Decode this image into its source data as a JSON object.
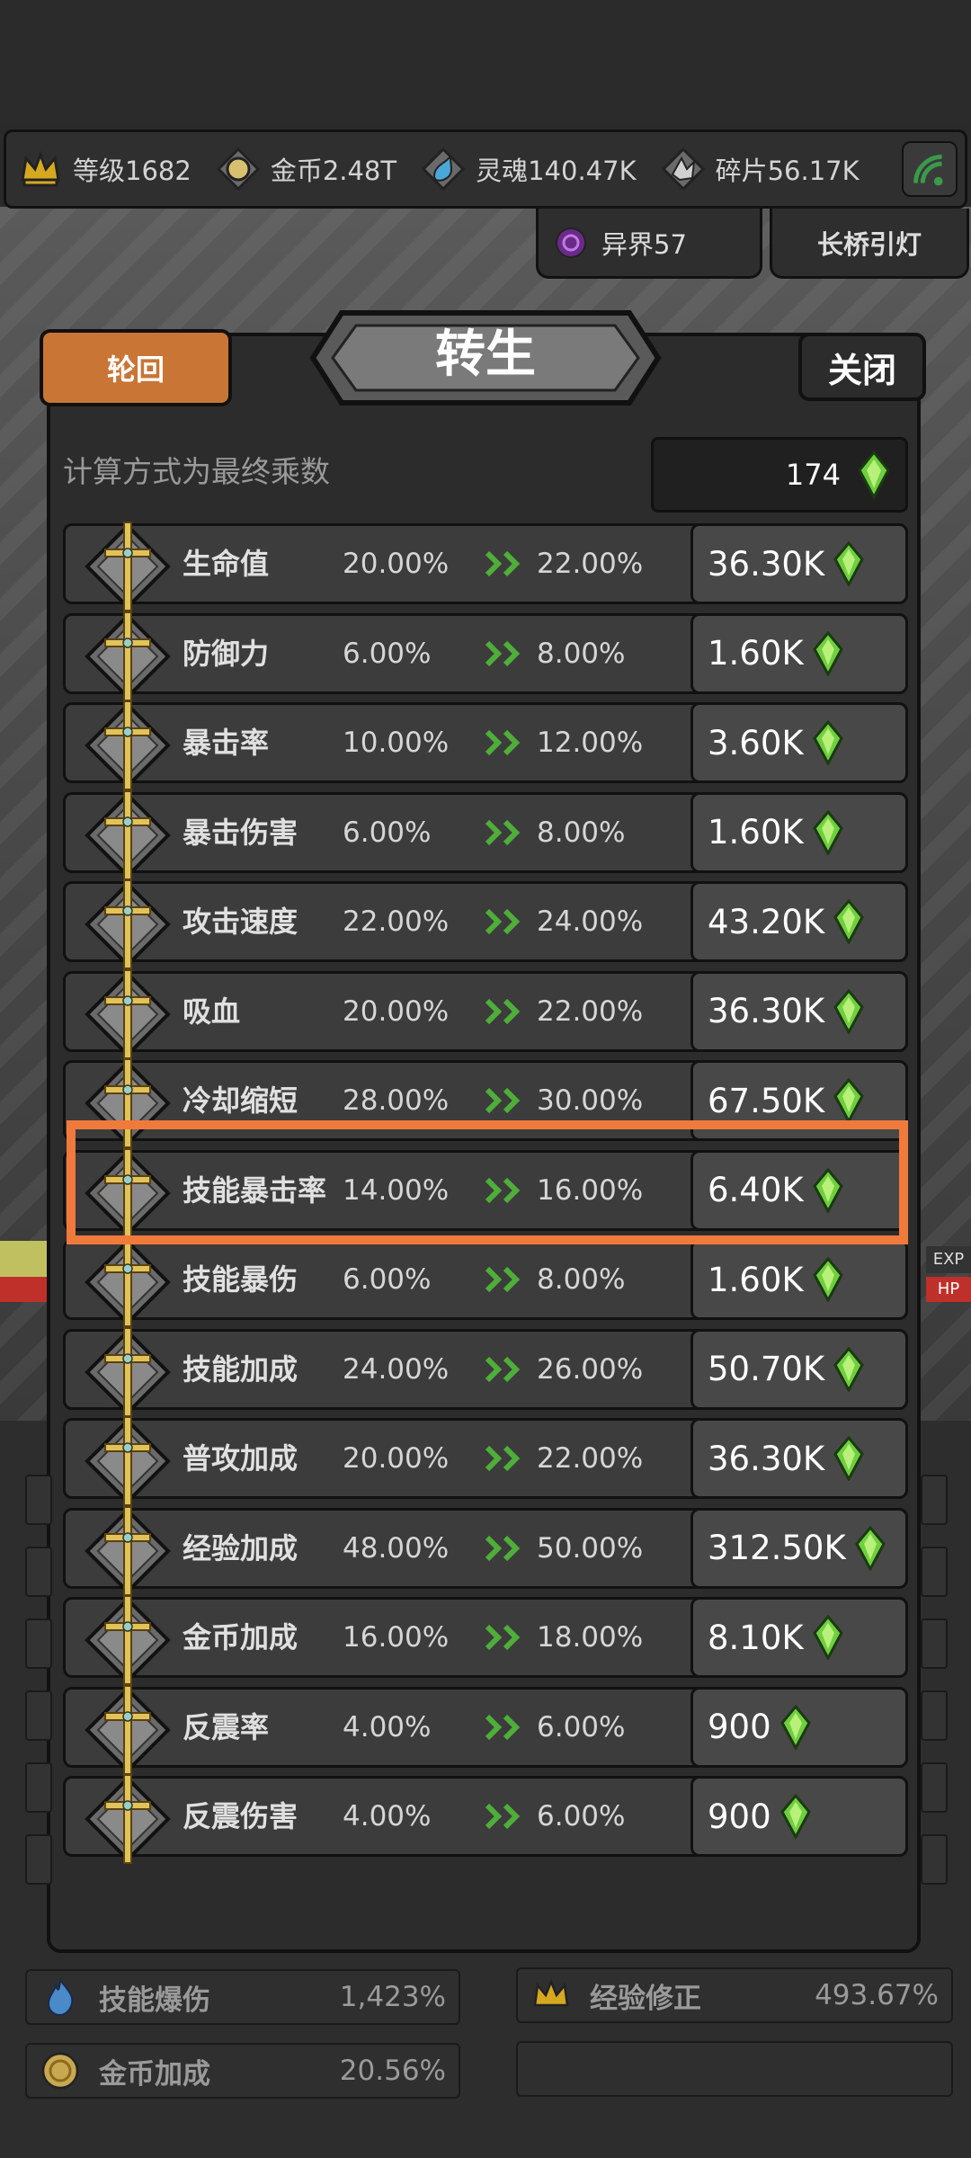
{
  "resources": [
    {
      "label": "等级1682",
      "icon": "crown-icon"
    },
    {
      "label": "金币2.48T",
      "icon": "coin-icon"
    },
    {
      "label": "灵魂140.47K",
      "icon": "soul-icon"
    },
    {
      "label": "碎片56.17K",
      "icon": "shard-icon"
    }
  ],
  "subbar": {
    "otherworld": "异界57",
    "lantern": "长桥引灯"
  },
  "panel": {
    "tab_label": "轮回",
    "title": "转生",
    "close_label": "关闭",
    "calc_note": "计算方式为最终乘数",
    "total_gems": "174"
  },
  "stats_rows": [
    {
      "name": "生命值",
      "current": "20.00%",
      "next": "22.00%",
      "cost": "36.30K"
    },
    {
      "name": "防御力",
      "current": "6.00%",
      "next": "8.00%",
      "cost": "1.60K"
    },
    {
      "name": "暴击率",
      "current": "10.00%",
      "next": "12.00%",
      "cost": "3.60K"
    },
    {
      "name": "暴击伤害",
      "current": "6.00%",
      "next": "8.00%",
      "cost": "1.60K"
    },
    {
      "name": "攻击速度",
      "current": "22.00%",
      "next": "24.00%",
      "cost": "43.20K"
    },
    {
      "name": "吸血",
      "current": "20.00%",
      "next": "22.00%",
      "cost": "36.30K"
    },
    {
      "name": "冷却缩短",
      "current": "28.00%",
      "next": "30.00%",
      "cost": "67.50K"
    },
    {
      "name": "技能暴击率",
      "current": "14.00%",
      "next": "16.00%",
      "cost": "6.40K"
    },
    {
      "name": "技能暴伤",
      "current": "6.00%",
      "next": "8.00%",
      "cost": "1.60K"
    },
    {
      "name": "技能加成",
      "current": "24.00%",
      "next": "26.00%",
      "cost": "50.70K"
    },
    {
      "name": "普攻加成",
      "current": "20.00%",
      "next": "22.00%",
      "cost": "36.30K"
    },
    {
      "name": "经验加成",
      "current": "48.00%",
      "next": "50.00%",
      "cost": "312.50K"
    },
    {
      "name": "金币加成",
      "current": "16.00%",
      "next": "18.00%",
      "cost": "8.10K"
    },
    {
      "name": "反震率",
      "current": "4.00%",
      "next": "6.00%",
      "cost": "900"
    },
    {
      "name": "反震伤害",
      "current": "4.00%",
      "next": "6.00%",
      "cost": "900"
    }
  ],
  "bottom_stats": [
    {
      "label": "技能爆伤",
      "value": "1,423%",
      "icon": "flame-icon"
    },
    {
      "label": "经验修正",
      "value": "493.67%",
      "icon": "crown-icon"
    },
    {
      "label": "金币加成",
      "value": "20.56%",
      "icon": "coin-icon"
    },
    {
      "label": "",
      "value": "",
      "icon": ""
    }
  ],
  "background": {
    "exp_tag": "EXP",
    "hp_tag": "HP"
  },
  "colors": {
    "accent": "#c97535",
    "highlight": "#f07a3c",
    "gem": "#6fcf3f",
    "arrow": "#4fae3a"
  }
}
